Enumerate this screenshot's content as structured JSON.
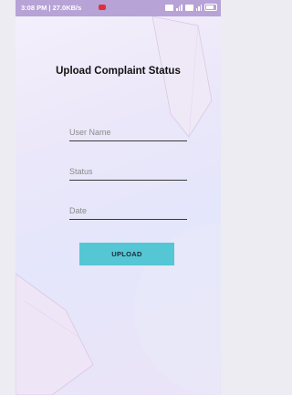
{
  "status_bar": {
    "time": "3:08 PM | 27.0KB/s"
  },
  "screen": {
    "title": "Upload Complaint Status"
  },
  "form": {
    "username_placeholder": "User Name",
    "status_placeholder": "Status",
    "date_placeholder": "Date",
    "upload_label": "UPLOAD"
  },
  "colors": {
    "status_bar": "#b7a3d6",
    "button": "#55c6d3",
    "recording_indicator": "#e0303c"
  },
  "icons": [
    "recording-icon",
    "sim-icon",
    "signal-icon",
    "battery-icon"
  ]
}
